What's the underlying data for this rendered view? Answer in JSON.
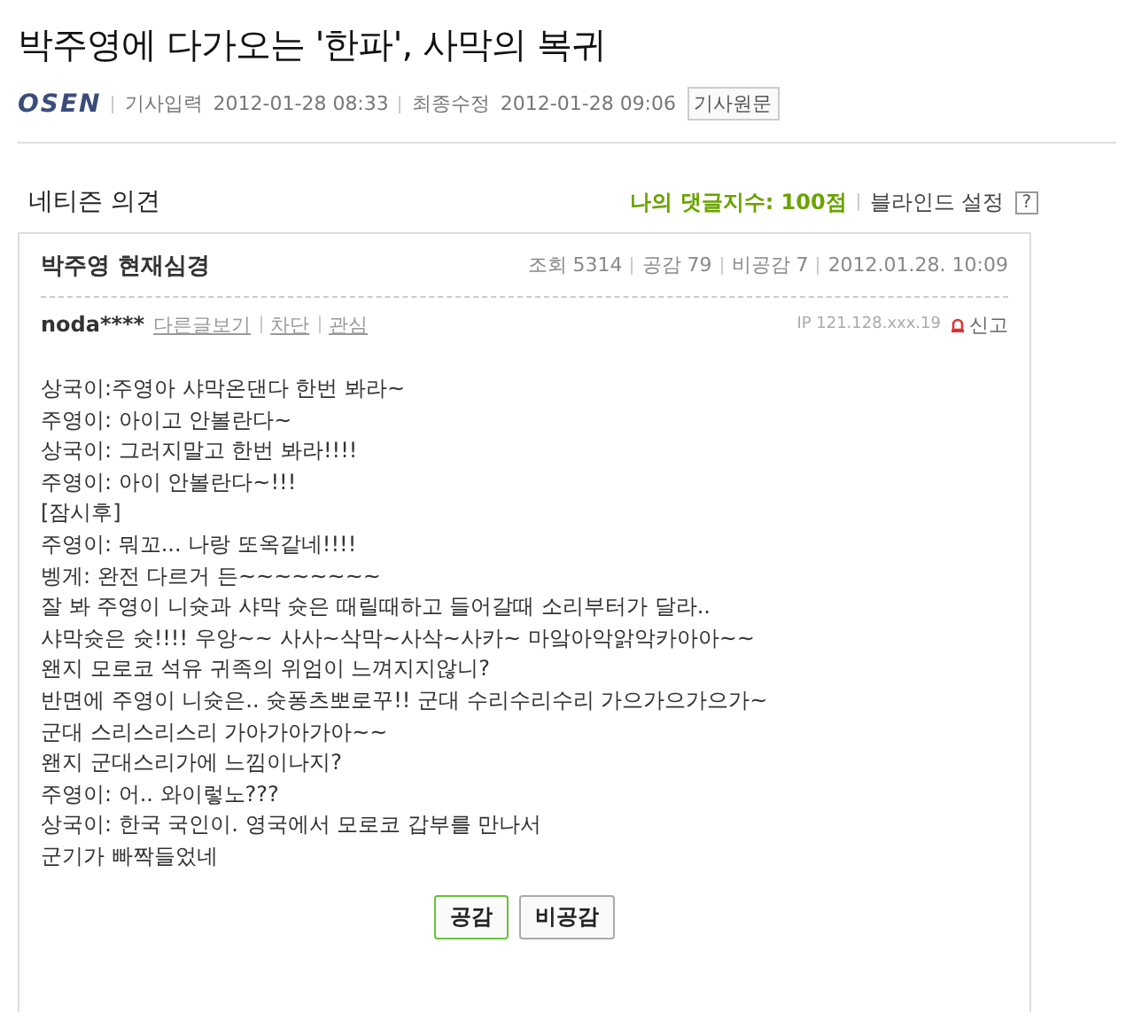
{
  "article": {
    "title": "박주영에 다가오는 '한파', 사막의 복귀",
    "source": "OSEN",
    "input_label": "기사입력",
    "input_time": "2012-01-28 08:33",
    "edit_label": "최종수정",
    "edit_time": "2012-01-28 09:06",
    "original_button": "기사원문"
  },
  "comments_header": {
    "title": "네티즌 의견",
    "my_count": "나의 댓글지수: 100점",
    "blind_setting": "블라인드 설정",
    "help": "?"
  },
  "comment": {
    "title": "박주영 현재심경",
    "stats": [
      "조회 5314",
      "공감 79",
      "비공감 7",
      "2012.01.28. 10:09"
    ],
    "author": "noda****",
    "author_links": [
      "다른글보기",
      "차단",
      "관심"
    ],
    "ip": "IP 121.128.xxx.19",
    "report": "신고",
    "lines": [
      "상국이:주영아 샤막온댄다 한번 봐라~",
      "주영이: 아이고 안볼란다~",
      "상국이: 그러지말고 한번 봐라!!!!",
      "주영이: 아이 안볼란다~!!!",
      "[잠시후]",
      "주영이: 뭐꼬... 나랑 또옥같네!!!!",
      "벵게: 완전 다르거 든~~~~~~~~",
      "잘 봐 주영이 니슛과 샤막 슛은 때릴때하고 들어갈때 소리부터가 달라..",
      "샤막슛은 슛!!!! 우앙~~ 사사~삭막~사삭~사카~ 마앜아악앍악카아아~~",
      "왠지 모로코 석유 귀족의 위엄이 느껴지지않니?",
      "반면에 주영이 니슛은.. 슛퐁츠뽀로꾸!! 군대 수리수리수리 가으가으가으가~",
      "군대 스리스리스리 가아가아가아~~",
      "왠지 군대스리가에 느낌이나지?",
      "주영이: 어.. 와이렇노???",
      "상국이: 한국 국인이. 영국에서 모로코 갑부를 만나서",
      "군기가 빠짝들었네"
    ],
    "buttons": [
      {
        "label": "공감",
        "selected": true
      },
      {
        "label": "비공감",
        "selected": false
      }
    ]
  }
}
